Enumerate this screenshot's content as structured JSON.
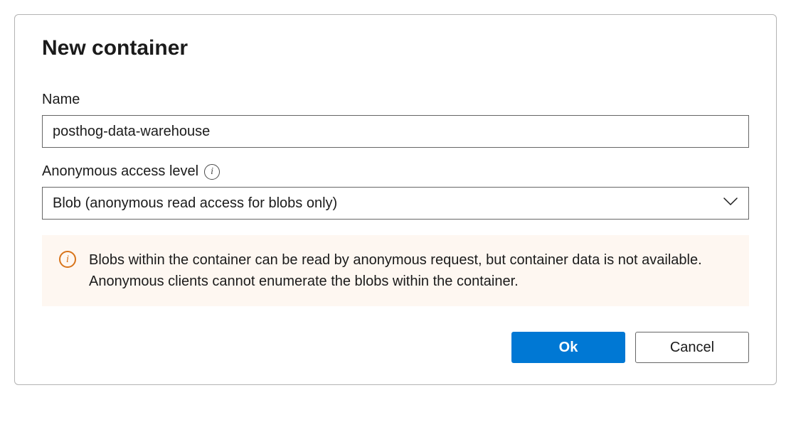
{
  "dialog": {
    "title": "New container"
  },
  "fields": {
    "name": {
      "label": "Name",
      "value": "posthog-data-warehouse"
    },
    "access_level": {
      "label": "Anonymous access level",
      "selected": "Blob (anonymous read access for blobs only)"
    }
  },
  "banner": {
    "text": "Blobs within the container can be read by anonymous request, but container data is not available. Anonymous clients cannot enumerate the blobs within the container."
  },
  "buttons": {
    "ok": "Ok",
    "cancel": "Cancel"
  }
}
